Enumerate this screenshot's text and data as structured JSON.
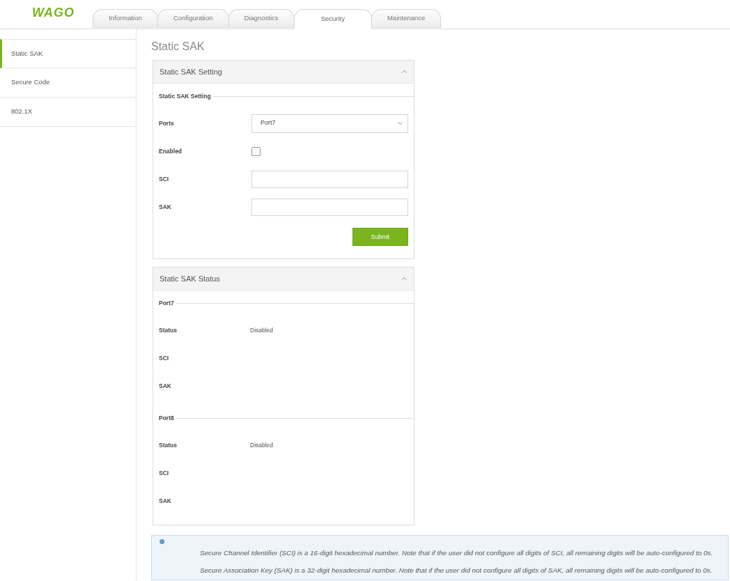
{
  "logo": {
    "text": "WAGO"
  },
  "tabs": [
    {
      "label": "Information",
      "selected": false
    },
    {
      "label": "Configuration",
      "selected": false
    },
    {
      "label": "Diagnostics",
      "selected": false
    },
    {
      "label": "Security",
      "selected": true
    },
    {
      "label": "Maintenance",
      "selected": false
    }
  ],
  "sidebar": {
    "items": [
      {
        "label": "Static SAK",
        "selected": true
      },
      {
        "label": "Secure Code",
        "selected": false
      },
      {
        "label": "802.1X",
        "selected": false
      }
    ]
  },
  "page_title": "Static SAK",
  "setting_panel": {
    "title": "Static SAK Setting",
    "expanded": true,
    "legend": "Static SAK Setting",
    "fields": [
      {
        "kind": "select",
        "label": "Ports",
        "value": "Port7"
      },
      {
        "kind": "checkbox",
        "label": "Enabled",
        "checked": false
      },
      {
        "kind": "text",
        "label": "SCI"
      },
      {
        "kind": "text",
        "label": "SAK"
      }
    ],
    "submit": "Submit"
  },
  "status_panel": {
    "title": "Static SAK Status",
    "expanded": true,
    "groups": [
      {
        "legend": "Port7",
        "rows": [
          {
            "label": "Status",
            "value": "Disabled"
          },
          {
            "label": "SCI"
          },
          {
            "label": "SAK"
          }
        ]
      },
      {
        "legend": "Port8",
        "rows": [
          {
            "label": "Status",
            "value": "Disabled"
          },
          {
            "label": "SCI"
          },
          {
            "label": "SAK"
          }
        ]
      }
    ]
  },
  "info": {
    "lines": [
      "Secure Channel Identifier (SCI) is a 16-digit hexadecimal number. Note that if the user did not configure all digits of SCI, all remaining digits will be auto-configured to 0s.",
      "Secure Association Key (SAK) is a 32-digit hexadecimal number. Note that if the user did not configure all digits of SAK, all remaining digits will be auto-configured to 0s."
    ]
  }
}
